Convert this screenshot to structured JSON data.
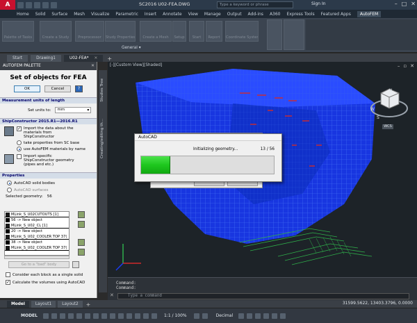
{
  "window": {
    "title": "SC2016   U02-FEA.DWG",
    "search_placeholder": "Type a keyword or phrase",
    "signin": "Sign In",
    "controls": [
      "–",
      "□",
      "✕"
    ]
  },
  "ribbon": {
    "tabs": [
      "Home",
      "Solid",
      "Surface",
      "Mesh",
      "Visualize",
      "Parametric",
      "Insert",
      "Annotate",
      "View",
      "Manage",
      "Output",
      "Add-ins",
      "A360",
      "Express Tools",
      "Featured Apps",
      "AutoFEM"
    ],
    "active_tab": "AutoFEM",
    "buttons": [
      "Palette of Tasks",
      "Create a Study",
      "Preprocessor",
      "Study Properties",
      "Create a Mesh",
      "Setup",
      "Start",
      "Report",
      "Coordinate System"
    ],
    "panel_label": "General"
  },
  "doc_tabs": [
    {
      "label": "Start",
      "active": false
    },
    {
      "label": "Drawing1",
      "active": false
    },
    {
      "label": "U02-FEA*",
      "active": true
    }
  ],
  "palette": {
    "title": "AUTOFEM PALETTE",
    "heading": "Set of objects for FEA",
    "ok_label": "OK",
    "cancel_label": "Cancel",
    "measurement": {
      "header": "Measurement units of length",
      "set_units_label": "Set units to:",
      "units_value": "mm"
    },
    "shipconstructor": {
      "header": "ShipConstructor 2015.R1—2016.R1",
      "import_materials_label": "Import the data about the materials from ShipConstructor",
      "import_materials_checked": true,
      "option_sc_base": "take properties from SC base",
      "option_autofem": "use AutoFEM materials by name",
      "selected_option": "autofem",
      "import_geometry_label": "Import specific ShipConstructor geometry (pipes and etc.)",
      "import_geometry_checked": false
    },
    "properties": {
      "header": "Properties",
      "option_solid": "AutoCAD solid bodies",
      "option_surfaces": "AutoCAD surfaces",
      "selected_geometry_label": "Selected geometry:",
      "selected_geometry_count": "56",
      "geometry_list": [
        {
          "text": "MLink_S_U02CUTOUTS  [1]",
          "head": true
        },
        {
          "text": "56 -> New object",
          "head": false
        },
        {
          "text": "MLink_S_U02_CL  [1]",
          "head": true
        },
        {
          "text": "20 -> New object",
          "head": false
        },
        {
          "text": "MLink_S_U02_COOLER TOP 37(",
          "head": true
        },
        {
          "text": "38 -> New object",
          "head": false
        },
        {
          "text": "MLink_S_U02_COOLER TOP 37(",
          "head": true
        }
      ],
      "goto_bad_label": "Go to a \"bad\" body",
      "each_block_label": "Consider each block as a single solid",
      "each_block_checked": false,
      "calc_volumes_label": "Calculate the volumes using AutoCAD",
      "calc_volumes_checked": true
    }
  },
  "side_tabs": [
    "Studies Tree",
    "Creating/editing th..."
  ],
  "viewport": {
    "label": "[-][Custom View][Shaded]",
    "viewcube_label": "WCS",
    "compass_labels": [
      "N",
      "S",
      "W"
    ]
  },
  "dialog": {
    "title": "AutoCAD",
    "message": "Initializing geometry...",
    "count": "13 / 56",
    "progress": 0.22,
    "progress_color": "#22c322"
  },
  "command": {
    "lines": [
      "Command:",
      "Command:"
    ],
    "input_placeholder": "Type a command"
  },
  "layout_tabs": [
    {
      "label": "Model",
      "active": true
    },
    {
      "label": "Layout1",
      "active": false
    },
    {
      "label": "Layout2",
      "active": false
    }
  ],
  "coords": "31599.5622, 13403.3796, 0.0000",
  "status": {
    "model_label": "MODEL",
    "scale": "1:1 / 100%",
    "units": "Decimal"
  },
  "colors": {
    "mesh_blue": "#1a3cf0",
    "mesh_red": "#d22a2a",
    "mesh_green": "#2fae4a",
    "accent_red": "#c8102e"
  }
}
